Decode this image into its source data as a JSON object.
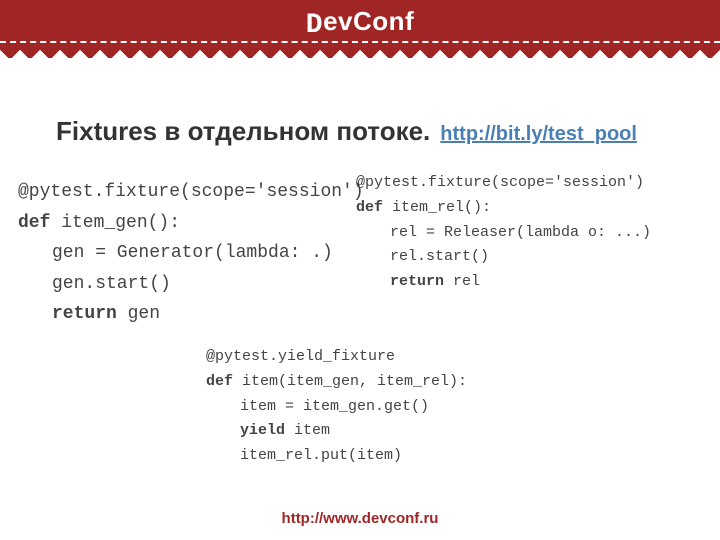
{
  "header": {
    "logo_prefix": "D",
    "logo_mid": "ev",
    "logo_c": "C",
    "logo_suffix": "onf"
  },
  "title": "Fixtures в отдельном потоке.",
  "link_text": "http://bit.ly/test_pool",
  "code_left": {
    "l1": "@pytest.fixture(scope='session')",
    "l2a": "def",
    "l2b": " item_gen():",
    "l3": "gen = Generator(lambda: .)",
    "l4": "gen.start()",
    "l5a": "return",
    "l5b": " gen"
  },
  "code_right": {
    "l1": "@pytest.fixture(scope='session')",
    "l2a": "def",
    "l2b": " item_rel():",
    "l3": "rel = Releaser(lambda o: ...)",
    "l4": "rel.start()",
    "l5a": "return",
    "l5b": " rel"
  },
  "code_bottom": {
    "l1": "@pytest.yield_fixture",
    "l2a": "def",
    "l2b": " item(item_gen, item_rel):",
    "l3": "item = item_gen.get()",
    "l4a": "yield",
    "l4b": " item",
    "l5": "item_rel.put(item)"
  },
  "footer": {
    "url": "http://www.devconf.ru"
  }
}
